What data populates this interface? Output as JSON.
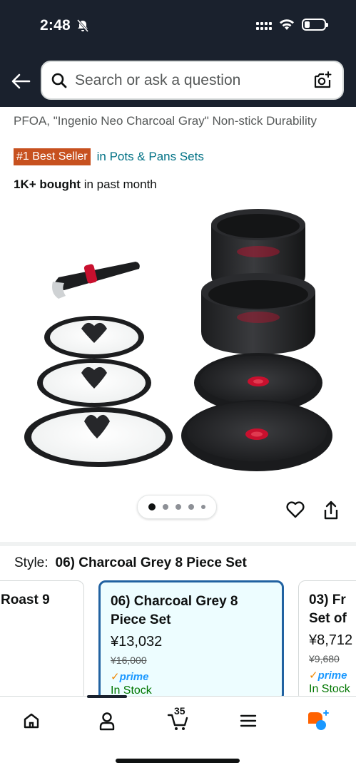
{
  "status_bar": {
    "time": "2:48"
  },
  "header": {
    "search_placeholder": "Search or ask a question"
  },
  "product": {
    "title_partial": "PFOA, \"Ingenio Neo Charcoal Gray\" Non-stick Durability",
    "best_seller_badge": "#1 Best Seller",
    "best_seller_category": "in Pots & Pans Sets",
    "bought_count": "1K+ bought",
    "bought_suffix": " in past month",
    "image_count": 5,
    "image_index": 1
  },
  "style_selector": {
    "label": "Style:",
    "selected": "06) Charcoal Grey 8 Piece Set",
    "options": [
      {
        "name": "Roast 9",
        "price": "",
        "old_price": "",
        "prime": "",
        "stock": ""
      },
      {
        "name": "06) Charcoal Grey 8 Piece Set",
        "price": "¥13,032",
        "old_price": "¥16,000",
        "prime": "prime",
        "stock": "In Stock"
      },
      {
        "name": "03) Fr Set of",
        "price": "¥8,712",
        "old_price": "¥9,680",
        "prime": "prime",
        "stock": "In Stock"
      }
    ]
  },
  "bottom_nav": {
    "cart_count": "35"
  },
  "colors": {
    "header_bg": "#1a212d",
    "best_seller": "#c7511f",
    "link": "#007185",
    "selected_border": "#2162a1",
    "prime": "#1a98ff"
  }
}
